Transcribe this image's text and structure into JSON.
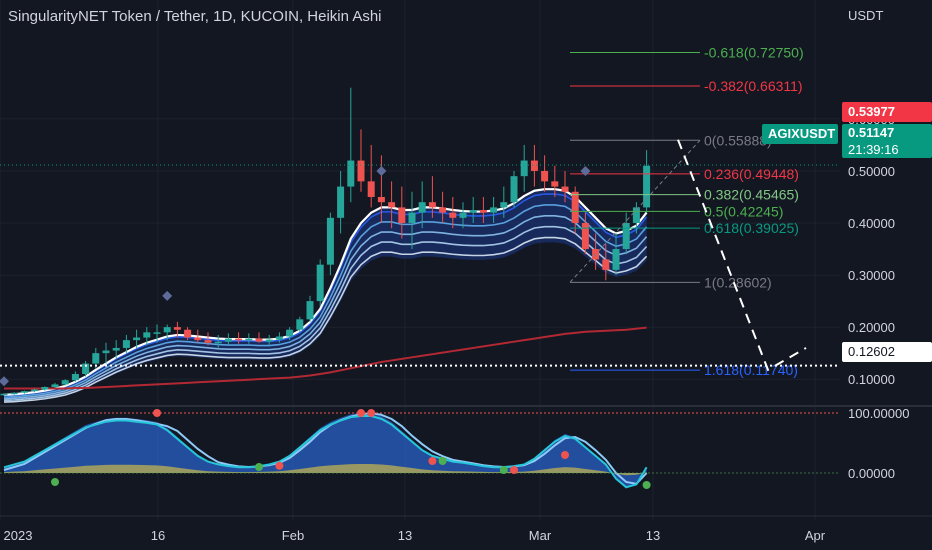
{
  "header": {
    "title": "SingularityNET Token / Tether, 1D, KUCOIN, Heikin Ashi"
  },
  "colors": {
    "background": "#131722",
    "up": "#26a69a",
    "down": "#ef5350",
    "ema_fast": "#ffffff",
    "ema_band": "#2962ff",
    "ema_slow": "#b22833",
    "osc_fill": "#2a62c8",
    "osc_line": "#26c6da",
    "osc_yellow": "#c9b84a"
  },
  "price_axis": {
    "unit": "USDT",
    "ticks": [
      "0.60000",
      "0.50000",
      "0.40000",
      "0.30000",
      "0.20000",
      "0.10000"
    ],
    "tick_values": [
      0.6,
      0.5,
      0.4,
      0.3,
      0.2,
      0.1
    ]
  },
  "osc_axis": {
    "ticks": [
      "100.00000",
      "0.00000"
    ]
  },
  "time_axis": {
    "ticks": [
      "2023",
      "16",
      "Feb",
      "13",
      "Mar",
      "13",
      "Apr"
    ]
  },
  "tags": {
    "last_close": "0.53977",
    "symbol": "AGIXUSDT",
    "price": "0.51147",
    "countdown": "21:39:16",
    "marker": "0.12602"
  },
  "fib_levels": [
    {
      "label": "-0.618(0.72750)",
      "value": 0.7275,
      "color": "#4caf50"
    },
    {
      "label": "-0.382(0.66311)",
      "value": 0.66311,
      "color": "#f23645"
    },
    {
      "label": "0(0.55888)",
      "value": 0.55888,
      "color": "#787b86"
    },
    {
      "label": "0.236(0.49448)",
      "value": 0.49448,
      "color": "#f23645"
    },
    {
      "label": "0.382(0.45465)",
      "value": 0.45465,
      "color": "#81c784"
    },
    {
      "label": "0.5(0.42245)",
      "value": 0.42245,
      "color": "#4caf50"
    },
    {
      "label": "0.618(0.39025)",
      "value": 0.39025,
      "color": "#089981"
    },
    {
      "label": "1(0.28602)",
      "value": 0.28602,
      "color": "#787b86"
    },
    {
      "label": "1.618(0.11740)",
      "value": 0.1174,
      "color": "#2962ff"
    }
  ],
  "chart_data": {
    "type": "candlestick",
    "title": "SingularityNET Token / Tether, 1D, KUCOIN, Heikin Ashi",
    "ylim": [
      0.06,
      0.79
    ],
    "x_start": "2023-01-02",
    "candles": [
      [
        0.07,
        0.073,
        0.068,
        0.072
      ],
      [
        0.072,
        0.075,
        0.07,
        0.074
      ],
      [
        0.074,
        0.078,
        0.072,
        0.077
      ],
      [
        0.077,
        0.082,
        0.075,
        0.08
      ],
      [
        0.08,
        0.086,
        0.078,
        0.085
      ],
      [
        0.085,
        0.093,
        0.083,
        0.09
      ],
      [
        0.09,
        0.1,
        0.088,
        0.098
      ],
      [
        0.098,
        0.115,
        0.095,
        0.11
      ],
      [
        0.11,
        0.135,
        0.105,
        0.13
      ],
      [
        0.13,
        0.16,
        0.12,
        0.15
      ],
      [
        0.15,
        0.17,
        0.13,
        0.155
      ],
      [
        0.155,
        0.175,
        0.14,
        0.16
      ],
      [
        0.16,
        0.185,
        0.15,
        0.175
      ],
      [
        0.175,
        0.195,
        0.16,
        0.18
      ],
      [
        0.18,
        0.2,
        0.165,
        0.19
      ],
      [
        0.19,
        0.205,
        0.17,
        0.19
      ],
      [
        0.19,
        0.205,
        0.175,
        0.2
      ],
      [
        0.2,
        0.21,
        0.18,
        0.195
      ],
      [
        0.195,
        0.2,
        0.175,
        0.18
      ],
      [
        0.18,
        0.195,
        0.17,
        0.175
      ],
      [
        0.175,
        0.19,
        0.165,
        0.17
      ],
      [
        0.17,
        0.185,
        0.16,
        0.172
      ],
      [
        0.172,
        0.188,
        0.165,
        0.178
      ],
      [
        0.178,
        0.19,
        0.168,
        0.175
      ],
      [
        0.175,
        0.188,
        0.168,
        0.178
      ],
      [
        0.178,
        0.19,
        0.17,
        0.172
      ],
      [
        0.172,
        0.185,
        0.165,
        0.176
      ],
      [
        0.176,
        0.19,
        0.17,
        0.182
      ],
      [
        0.182,
        0.2,
        0.175,
        0.195
      ],
      [
        0.195,
        0.22,
        0.19,
        0.215
      ],
      [
        0.215,
        0.26,
        0.21,
        0.25
      ],
      [
        0.25,
        0.33,
        0.24,
        0.32
      ],
      [
        0.32,
        0.42,
        0.3,
        0.41
      ],
      [
        0.41,
        0.5,
        0.38,
        0.47
      ],
      [
        0.47,
        0.66,
        0.44,
        0.52
      ],
      [
        0.52,
        0.58,
        0.46,
        0.48
      ],
      [
        0.48,
        0.55,
        0.43,
        0.45
      ],
      [
        0.45,
        0.53,
        0.4,
        0.44
      ],
      [
        0.44,
        0.48,
        0.39,
        0.43
      ],
      [
        0.43,
        0.47,
        0.37,
        0.4
      ],
      [
        0.4,
        0.46,
        0.35,
        0.42
      ],
      [
        0.42,
        0.48,
        0.39,
        0.44
      ],
      [
        0.44,
        0.49,
        0.41,
        0.43
      ],
      [
        0.43,
        0.46,
        0.4,
        0.42
      ],
      [
        0.42,
        0.45,
        0.39,
        0.41
      ],
      [
        0.41,
        0.44,
        0.39,
        0.42
      ],
      [
        0.42,
        0.45,
        0.4,
        0.425
      ],
      [
        0.425,
        0.45,
        0.4,
        0.42
      ],
      [
        0.42,
        0.45,
        0.4,
        0.43
      ],
      [
        0.43,
        0.47,
        0.41,
        0.44
      ],
      [
        0.44,
        0.5,
        0.43,
        0.49
      ],
      [
        0.49,
        0.55,
        0.46,
        0.52
      ],
      [
        0.52,
        0.55,
        0.47,
        0.5
      ],
      [
        0.5,
        0.53,
        0.46,
        0.48
      ],
      [
        0.48,
        0.51,
        0.45,
        0.47
      ],
      [
        0.47,
        0.5,
        0.44,
        0.46
      ],
      [
        0.46,
        0.47,
        0.38,
        0.4
      ],
      [
        0.4,
        0.42,
        0.34,
        0.35
      ],
      [
        0.35,
        0.38,
        0.31,
        0.33
      ],
      [
        0.33,
        0.36,
        0.29,
        0.31
      ],
      [
        0.31,
        0.38,
        0.3,
        0.35
      ],
      [
        0.35,
        0.42,
        0.34,
        0.4
      ],
      [
        0.4,
        0.44,
        0.38,
        0.43
      ],
      [
        0.43,
        0.54,
        0.42,
        0.51
      ]
    ],
    "ema_fast": [
      0.07,
      0.071,
      0.073,
      0.075,
      0.078,
      0.082,
      0.087,
      0.095,
      0.105,
      0.118,
      0.13,
      0.142,
      0.152,
      0.162,
      0.17,
      0.176,
      0.182,
      0.185,
      0.184,
      0.182,
      0.18,
      0.178,
      0.177,
      0.177,
      0.177,
      0.176,
      0.176,
      0.178,
      0.183,
      0.193,
      0.21,
      0.235,
      0.275,
      0.32,
      0.37,
      0.4,
      0.42,
      0.43,
      0.43,
      0.425,
      0.425,
      0.43,
      0.43,
      0.428,
      0.425,
      0.423,
      0.422,
      0.422,
      0.424,
      0.428,
      0.438,
      0.452,
      0.462,
      0.465,
      0.465,
      0.462,
      0.45,
      0.43,
      0.41,
      0.39,
      0.38,
      0.385,
      0.395,
      0.42
    ],
    "ema_slow": [
      0.082,
      0.082,
      0.082,
      0.082,
      0.082,
      0.082,
      0.082,
      0.083,
      0.083,
      0.084,
      0.085,
      0.086,
      0.087,
      0.088,
      0.089,
      0.09,
      0.091,
      0.092,
      0.093,
      0.094,
      0.095,
      0.096,
      0.097,
      0.098,
      0.099,
      0.1,
      0.101,
      0.102,
      0.103,
      0.105,
      0.107,
      0.11,
      0.113,
      0.117,
      0.121,
      0.125,
      0.129,
      0.133,
      0.136,
      0.139,
      0.142,
      0.145,
      0.148,
      0.151,
      0.154,
      0.157,
      0.16,
      0.163,
      0.166,
      0.169,
      0.172,
      0.175,
      0.178,
      0.181,
      0.184,
      0.187,
      0.189,
      0.191,
      0.192,
      0.193,
      0.194,
      0.195,
      0.197,
      0.199
    ],
    "oscillator": {
      "main": [
        10,
        15,
        20,
        30,
        40,
        50,
        60,
        70,
        80,
        85,
        90,
        92,
        92,
        90,
        88,
        85,
        75,
        60,
        45,
        30,
        20,
        15,
        12,
        10,
        10,
        12,
        15,
        20,
        30,
        45,
        60,
        75,
        85,
        92,
        98,
        100,
        100,
        95,
        85,
        70,
        55,
        40,
        30,
        25,
        20,
        18,
        15,
        12,
        10,
        10,
        12,
        15,
        25,
        40,
        55,
        65,
        60,
        45,
        30,
        15,
        -10,
        -25,
        -20,
        10
      ],
      "signal": [
        5,
        10,
        15,
        25,
        35,
        45,
        55,
        65,
        75,
        82,
        88,
        90,
        90,
        88,
        85,
        82,
        78,
        70,
        55,
        40,
        28,
        18,
        14,
        11,
        10,
        11,
        13,
        17,
        25,
        38,
        52,
        68,
        80,
        88,
        94,
        98,
        100,
        97,
        90,
        78,
        62,
        48,
        36,
        28,
        22,
        19,
        16,
        13,
        11,
        10,
        11,
        13,
        20,
        32,
        46,
        58,
        60,
        52,
        38,
        22,
        0,
        -15,
        -18,
        0
      ]
    }
  }
}
